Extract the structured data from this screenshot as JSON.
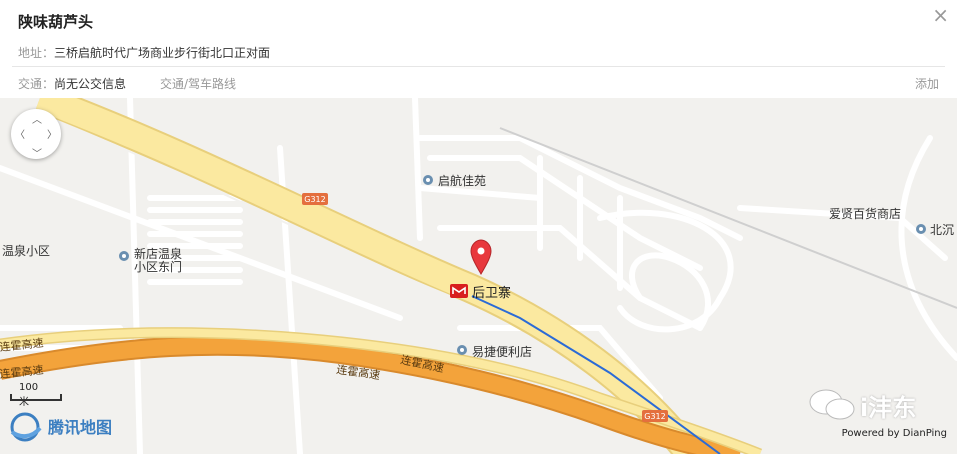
{
  "place": {
    "title": "陕味葫芦头",
    "address_label": "地址：",
    "address": "三桥启航时代广场商业步行街北口正对面",
    "traffic_label": "交通：",
    "traffic_value": "尚无公交信息",
    "route_link": "交通/驾车路线",
    "add_link": "添加",
    "close_glyph": "×"
  },
  "map": {
    "labels": {
      "qihang": "启航佳苑",
      "aixian": "爱贤百货商店",
      "bei": "北沉",
      "wenquan": "温泉小区",
      "xindian1": "新店温泉",
      "xindian2": "小区东门",
      "houwei": "后卫寨",
      "yijie": "易捷便利店",
      "lianhuo1": "连霍高速",
      "lianhuo2": "连霍高速",
      "lianhuo3": "连霍高速",
      "lianhuo4": "连霍高速",
      "g312_a": "G312",
      "g312_b": "G312"
    },
    "scale_label": "100 米",
    "logo_text": "腾讯地图",
    "watermark": "i沣东",
    "powered_by": "Powered by DianPing",
    "colors": {
      "background": "#f2f1ee",
      "expressway": "#f3a33b",
      "national_road": "#fbe9a0",
      "metro_line": "#2b6bd6",
      "marker": "#e8383d",
      "metro_icon": "#d81e1e"
    }
  }
}
